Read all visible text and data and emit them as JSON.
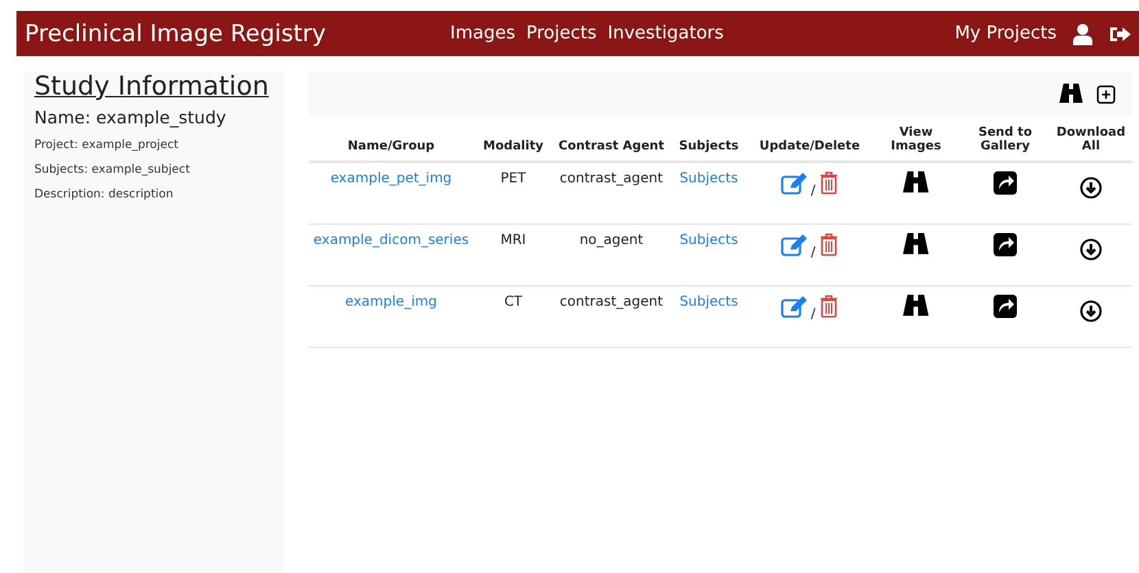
{
  "navbar": {
    "brand": "Preclinical Image Registry",
    "links": [
      "Images",
      "Projects",
      "Investigators"
    ],
    "right_link": "My Projects"
  },
  "sidebar": {
    "title": "Study Information",
    "name": "Name: example_study",
    "details": [
      "Project: example_project",
      "Subjects: example_subject",
      "Description: description"
    ]
  },
  "table": {
    "columns": [
      "Name/Group",
      "Modality",
      "Contrast Agent",
      "Subjects",
      "Update/Delete",
      "View Images",
      "Send to Gallery",
      "Download All"
    ],
    "rows": [
      {
        "name": "example_pet_img",
        "modality": "PET",
        "contrast_agent": "contrast_agent",
        "subjects": "Subjects",
        "separator": "/"
      },
      {
        "name": "example_dicom_series",
        "modality": "MRI",
        "contrast_agent": "no_agent",
        "subjects": "Subjects",
        "separator": "/"
      },
      {
        "name": "example_img",
        "modality": "CT",
        "contrast_agent": "contrast_agent",
        "subjects": "Subjects",
        "separator": "/"
      }
    ]
  }
}
